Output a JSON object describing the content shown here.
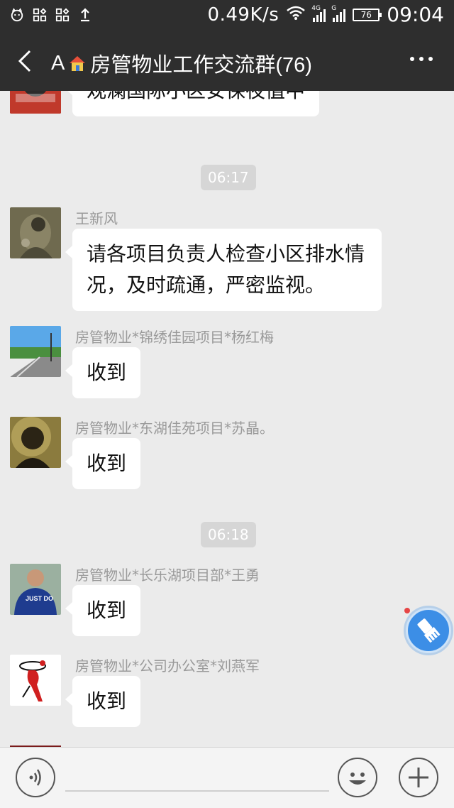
{
  "status_bar": {
    "net_speed": "0.49K/s",
    "sig1_label": "4G",
    "sig2_label": "G",
    "battery": "76",
    "time": "09:04"
  },
  "header": {
    "title_prefix": "A",
    "title": "房管物业工作交流群(76)"
  },
  "messages": [
    {
      "sender": "",
      "text": "观澜国际小区安保夜值中"
    },
    {
      "timestamp": "06:17"
    },
    {
      "sender": "王新风",
      "text": "请各项目负责人检查小区排水情况，及时疏通，严密监视。"
    },
    {
      "sender": "房管物业*锦绣佳园项目*杨红梅",
      "text": "收到"
    },
    {
      "sender": "房管物业*东湖佳苑项目*苏晶。",
      "text": "收到"
    },
    {
      "timestamp": "06:18"
    },
    {
      "sender": "房管物业*长乐湖项目部*王勇",
      "text": "收到"
    },
    {
      "sender": "房管物业*公司办公室*刘燕军",
      "text": "收到"
    }
  ],
  "avatar_text": {
    "wangyong": "JUST DO"
  },
  "input": {
    "placeholder": ""
  },
  "colors": {
    "header_bg": "#2e2e2e",
    "chat_bg": "#ebebeb",
    "float_button": "#3c8ee6",
    "notification_dot": "#e64545"
  }
}
